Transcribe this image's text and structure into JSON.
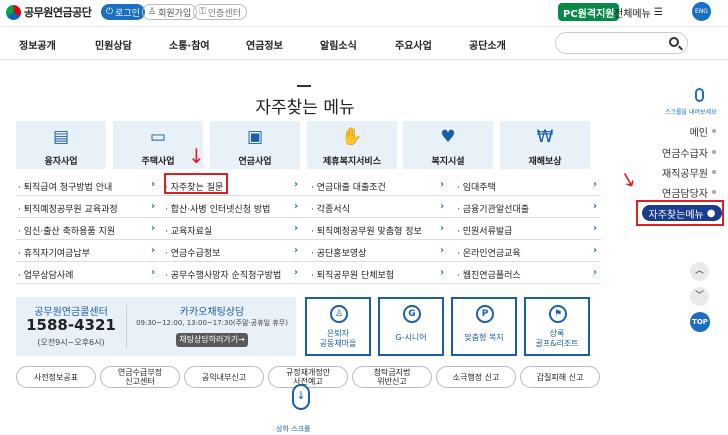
{
  "header": {
    "logo_text": "공무원연금공단",
    "login": "로그인",
    "join": "회원가입",
    "cert": "인증센터",
    "pc_remote": "PC원격지원",
    "all_menu": "전체메뉴",
    "eng": "ENG"
  },
  "gnb": [
    "정보공개",
    "민원상담",
    "소통·참여",
    "연금정보",
    "알림소식",
    "주요사업",
    "공단소개"
  ],
  "title": "자주찾는 메뉴",
  "categories": [
    {
      "label": "융자사업",
      "icon": "▤"
    },
    {
      "label": "주택사업",
      "icon": "▭"
    },
    {
      "label": "연금사업",
      "icon": "▣"
    },
    {
      "label": "제휴복지서비스",
      "icon": "✋"
    },
    {
      "label": "복지시설",
      "icon": "♥"
    },
    {
      "label": "재해보상",
      "icon": "₩"
    }
  ],
  "links": [
    [
      "퇴직급여 청구방법 안내",
      "자주찾는 질문",
      "연금대출 대출조건",
      "임대주택"
    ],
    [
      "퇴직예정공무원 교육과정",
      "합산·사병 인터넷신청 방법",
      "각종서식",
      "금융기관알선대출"
    ],
    [
      "임신·출산 축하용품 지원",
      "교육자료실",
      "퇴직예정공무원 맞춤형 정보",
      "민원서류발급"
    ],
    [
      "휴직자기여금납부",
      "연금수급정보",
      "공단홍보영상",
      "온라인연금교육"
    ],
    [
      "업무상담사례",
      "공무수행사망자 순직청구방법",
      "퇴직공무원 단체보험",
      "웹진연금플러스"
    ]
  ],
  "call_center": {
    "title": "공무원연금콜센터",
    "number": "1588-4321",
    "hours": "(오전9시~오후6시)"
  },
  "kakao": {
    "title": "카카오채팅상담",
    "hours": "09:30~12:00, 13:00~17:30(주말·공휴일 휴무)",
    "button": "채팅상담하러가기→"
  },
  "services": [
    {
      "label_1": "은퇴자",
      "label_2": "공동체마을",
      "icon": "♙"
    },
    {
      "label_1": "G-시니어",
      "label_2": "",
      "icon": "G"
    },
    {
      "label_1": "맞춤형 복지",
      "label_2": "",
      "icon": "P"
    },
    {
      "label_1": "상록",
      "label_2": "골프&리조트",
      "icon": "⚑"
    }
  ],
  "reports": [
    [
      "사전정보공표"
    ],
    [
      "연금수급부정",
      "신고센터"
    ],
    [
      "공익내부신고"
    ],
    [
      "규정재개정안",
      "사전예고"
    ],
    [
      "청탁금지법",
      "위반신고"
    ],
    [
      "소극행정 신고"
    ],
    [
      "갑질피해 신고"
    ]
  ],
  "scroll_text": "상하 스크롤",
  "side": {
    "scroll_hint": "스크롤을 내려보세요",
    "items": [
      "메인",
      "연금수급자",
      "재직공무원",
      "연금담당자"
    ],
    "active": "자주찾는메뉴",
    "top": "TOP"
  },
  "colors": {
    "accent": "#1a6fc2",
    "highlight": "#e02020",
    "active_side": "#1a3c8c",
    "remote": "#0a8a4a"
  }
}
